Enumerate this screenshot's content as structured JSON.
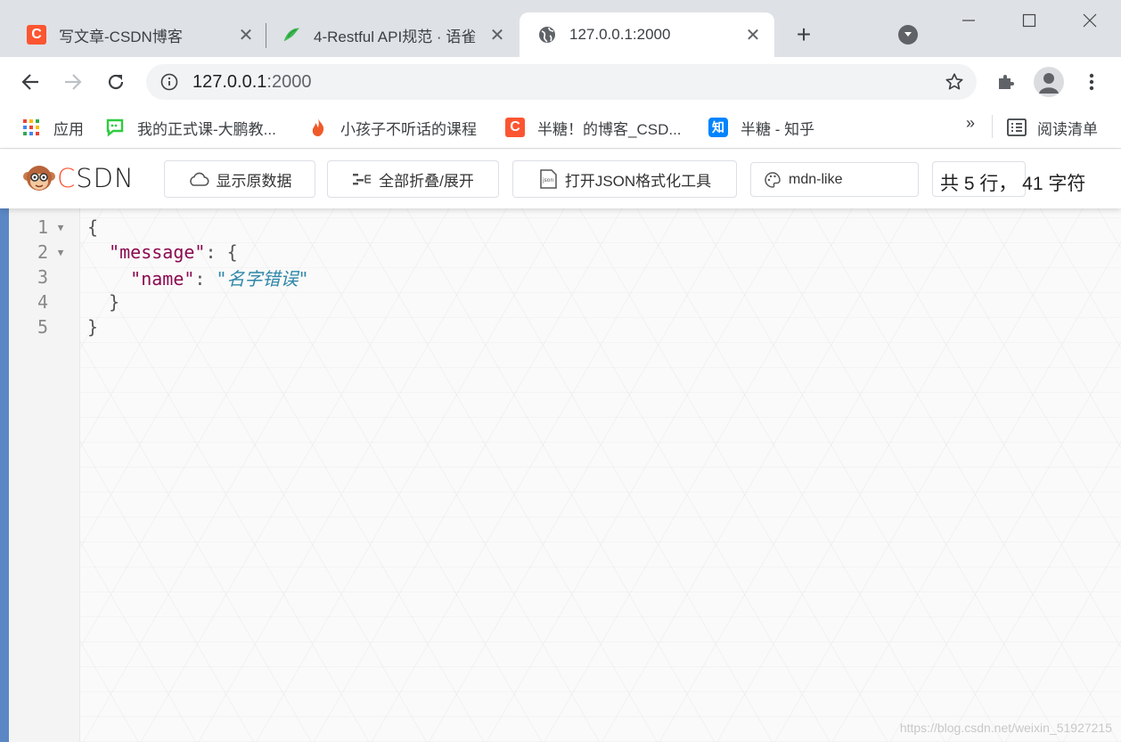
{
  "browser": {
    "tabs": [
      {
        "title": "写文章-CSDN博客",
        "icon": "csdn-c-icon",
        "icon_color": "#fc5531"
      },
      {
        "title": "4-Restful API规范 · 语雀",
        "icon": "yuque-bird-icon",
        "icon_color": "#3fb950"
      },
      {
        "title": "127.0.0.1:2000",
        "icon": "globe-icon",
        "active": true
      }
    ],
    "window_controls": [
      "minimize",
      "maximize",
      "close"
    ]
  },
  "address_bar": {
    "host": "127.0.0.1",
    "port": ":2000"
  },
  "bookmarks": [
    {
      "label": "应用",
      "icon": "apps-grid-icon"
    },
    {
      "label": "我的正式课-大鹏教...",
      "icon": "green-chat-icon"
    },
    {
      "label": "小孩子不听话的课程",
      "icon": "flame-icon"
    },
    {
      "label": "半糖！的博客_CSD...",
      "icon": "csdn-c-icon"
    },
    {
      "label": "半糖 - 知乎",
      "icon": "zhihu-icon"
    }
  ],
  "bookmarks_more": "»",
  "reading_list": "阅读清单",
  "json_viewer": {
    "brand": {
      "c": "C",
      "rest": "SDN"
    },
    "buttons": {
      "raw": "显示原数据",
      "fold": "全部折叠/展开",
      "formatter": "打开JSON格式化工具"
    },
    "theme": "mdn-like",
    "stats": {
      "lines": "5",
      "chars": "41",
      "text": "共 5 行， 41 字符"
    }
  },
  "editor": {
    "lines": [
      {
        "n": "1",
        "fold": true
      },
      {
        "n": "2",
        "fold": true
      },
      {
        "n": "3",
        "fold": false
      },
      {
        "n": "4",
        "fold": false
      },
      {
        "n": "5",
        "fold": false
      }
    ],
    "tokens": {
      "open_brace": "{",
      "key_message": "\"message\"",
      "colon": ": ",
      "key_name": "\"name\"",
      "value_name": "\"名字错误\"",
      "close_brace": "}"
    }
  },
  "watermark": "https://blog.csdn.net/weixin_51927215",
  "colors": {
    "csdn_red": "#fc5531",
    "json_key": "#8b0a50",
    "json_string": "#2e86a8"
  }
}
